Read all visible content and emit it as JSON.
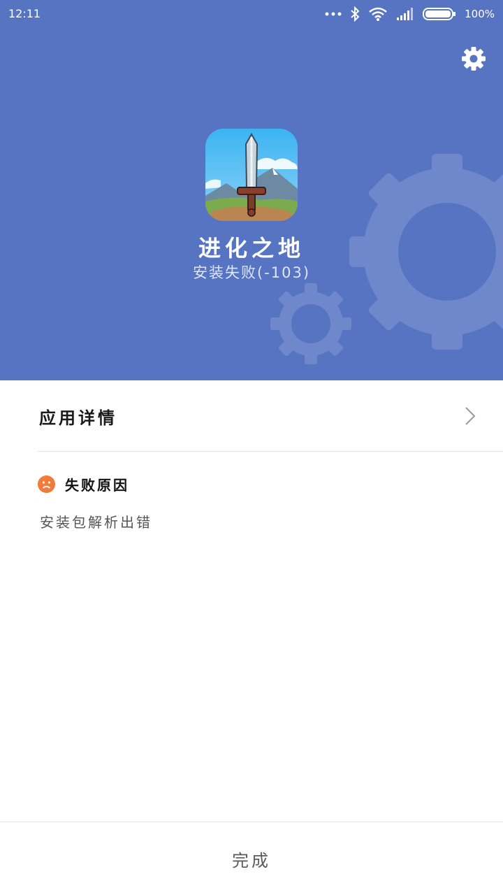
{
  "status_bar": {
    "time": "12:11",
    "battery": "100%",
    "icons": [
      "more-dots-icon",
      "bluetooth-icon",
      "wifi-icon",
      "signal-icon",
      "battery-icon"
    ]
  },
  "header": {
    "background_color": "#5674c2",
    "app_name": "进化之地",
    "install_status": "安装失败(-103)"
  },
  "details": {
    "label": "应用详情"
  },
  "failure": {
    "title": "失败原因",
    "reason": "安装包解析出错",
    "icon_color": "#f37b3a"
  },
  "footer": {
    "done_label": "完成"
  }
}
